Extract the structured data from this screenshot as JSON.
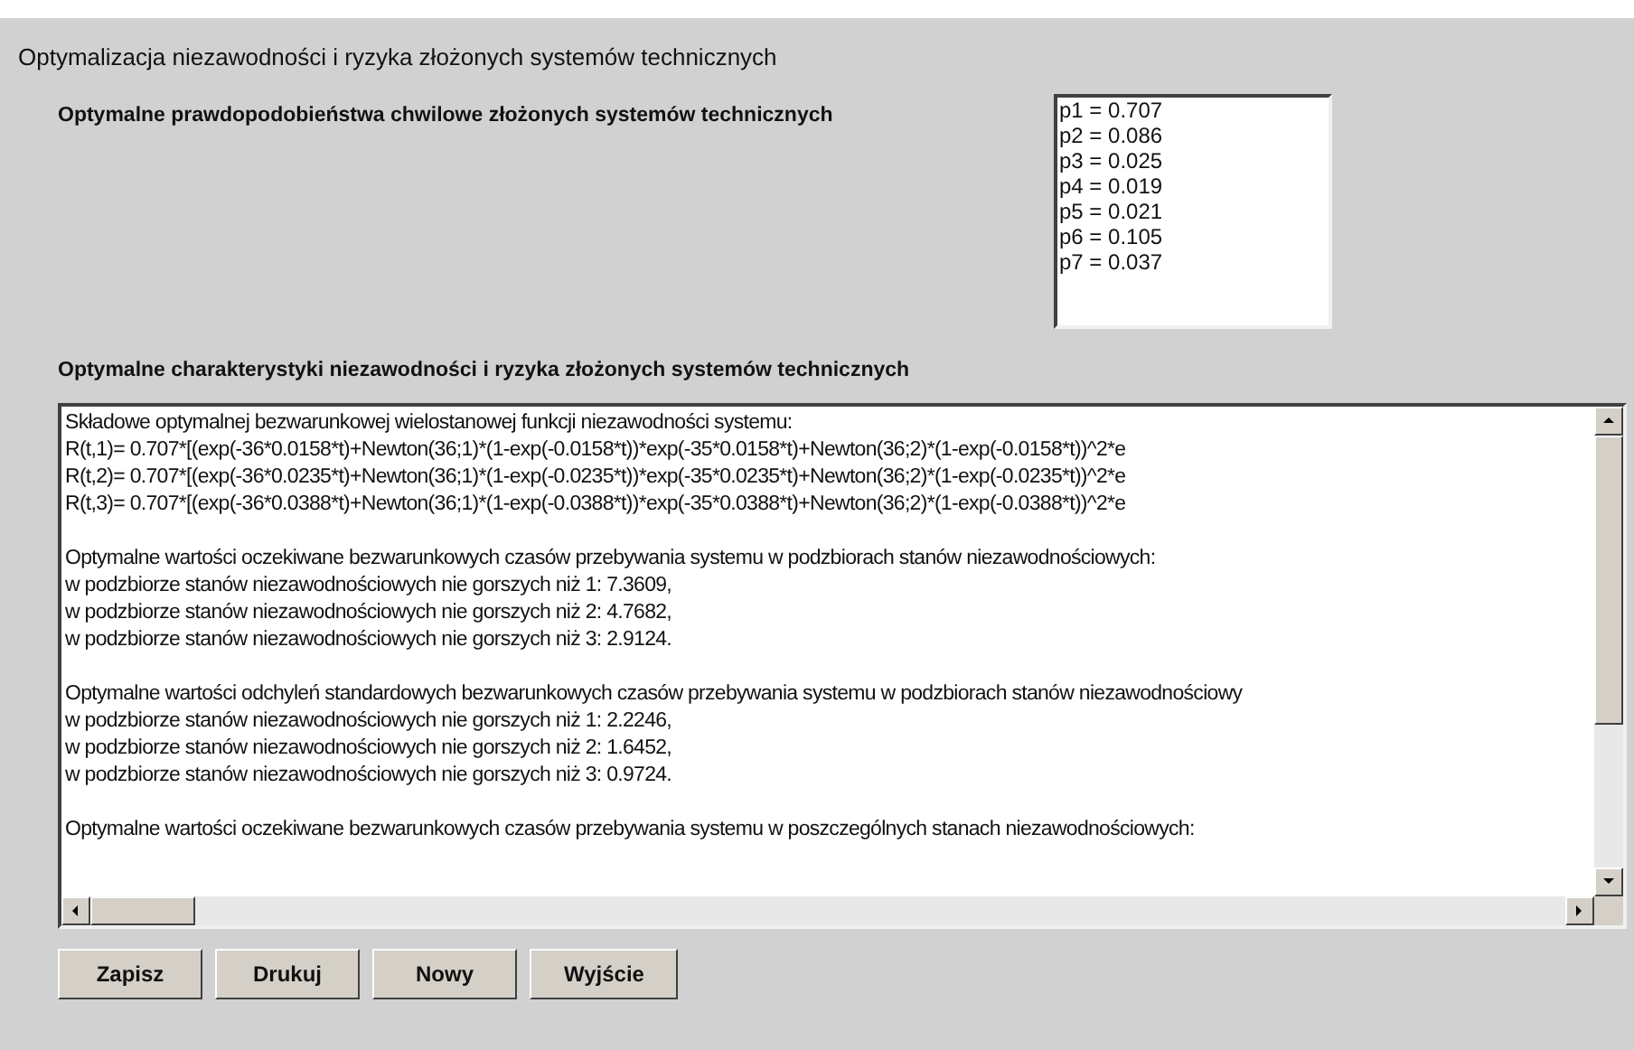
{
  "window": {
    "title": "Optymalizacja niezawodności i ryzyka złożonych systemów technicznych"
  },
  "probabilities": {
    "label": "Optymalne prawdopodobieństwa chwilowe złożonych systemów technicznych",
    "items": [
      "p1 = 0.707",
      "p2 = 0.086",
      "p3 = 0.025",
      "p4 = 0.019",
      "p5 = 0.021",
      "p6 = 0.105",
      "p7 = 0.037"
    ]
  },
  "characteristics": {
    "label": "Optymalne charakterystyki niezawodności i ryzyka złożonych systemów technicznych",
    "paragraphs": [
      [
        "Składowe optymalnej bezwarunkowej wielostanowej funkcji niezawodności systemu:",
        "R(t,1)= 0.707*[(exp(-36*0.0158*t)+Newton(36;1)*(1-exp(-0.0158*t))*exp(-35*0.0158*t)+Newton(36;2)*(1-exp(-0.0158*t))^2*e",
        "R(t,2)= 0.707*[(exp(-36*0.0235*t)+Newton(36;1)*(1-exp(-0.0235*t))*exp(-35*0.0235*t)+Newton(36;2)*(1-exp(-0.0235*t))^2*e",
        "R(t,3)= 0.707*[(exp(-36*0.0388*t)+Newton(36;1)*(1-exp(-0.0388*t))*exp(-35*0.0388*t)+Newton(36;2)*(1-exp(-0.0388*t))^2*e"
      ],
      [
        "Optymalne wartości oczekiwane bezwarunkowych czasów przebywania systemu w podzbiorach stanów niezawodnościowych:",
        "w podzbiorze stanów niezawodnościowych nie gorszych niż 1: 7.3609,",
        "w podzbiorze stanów niezawodnościowych nie gorszych niż 2: 4.7682,",
        "w podzbiorze stanów niezawodnościowych nie gorszych niż 3: 2.9124."
      ],
      [
        "Optymalne wartości odchyleń standardowych bezwarunkowych czasów przebywania systemu w podzbiorach stanów niezawodnościowy",
        "w podzbiorze stanów niezawodnościowych nie gorszych niż 1: 2.2246,",
        "w podzbiorze stanów niezawodnościowych nie gorszych niż 2: 1.6452,",
        "w podzbiorze stanów niezawodnościowych nie gorszych niż 3: 0.9724."
      ],
      [
        "Optymalne wartości oczekiwane bezwarunkowych czasów przebywania systemu w poszczególnych stanach niezawodnościowych:"
      ]
    ]
  },
  "buttons": [
    "Zapisz",
    "Drukuj",
    "Nowy",
    "Wyjście"
  ]
}
